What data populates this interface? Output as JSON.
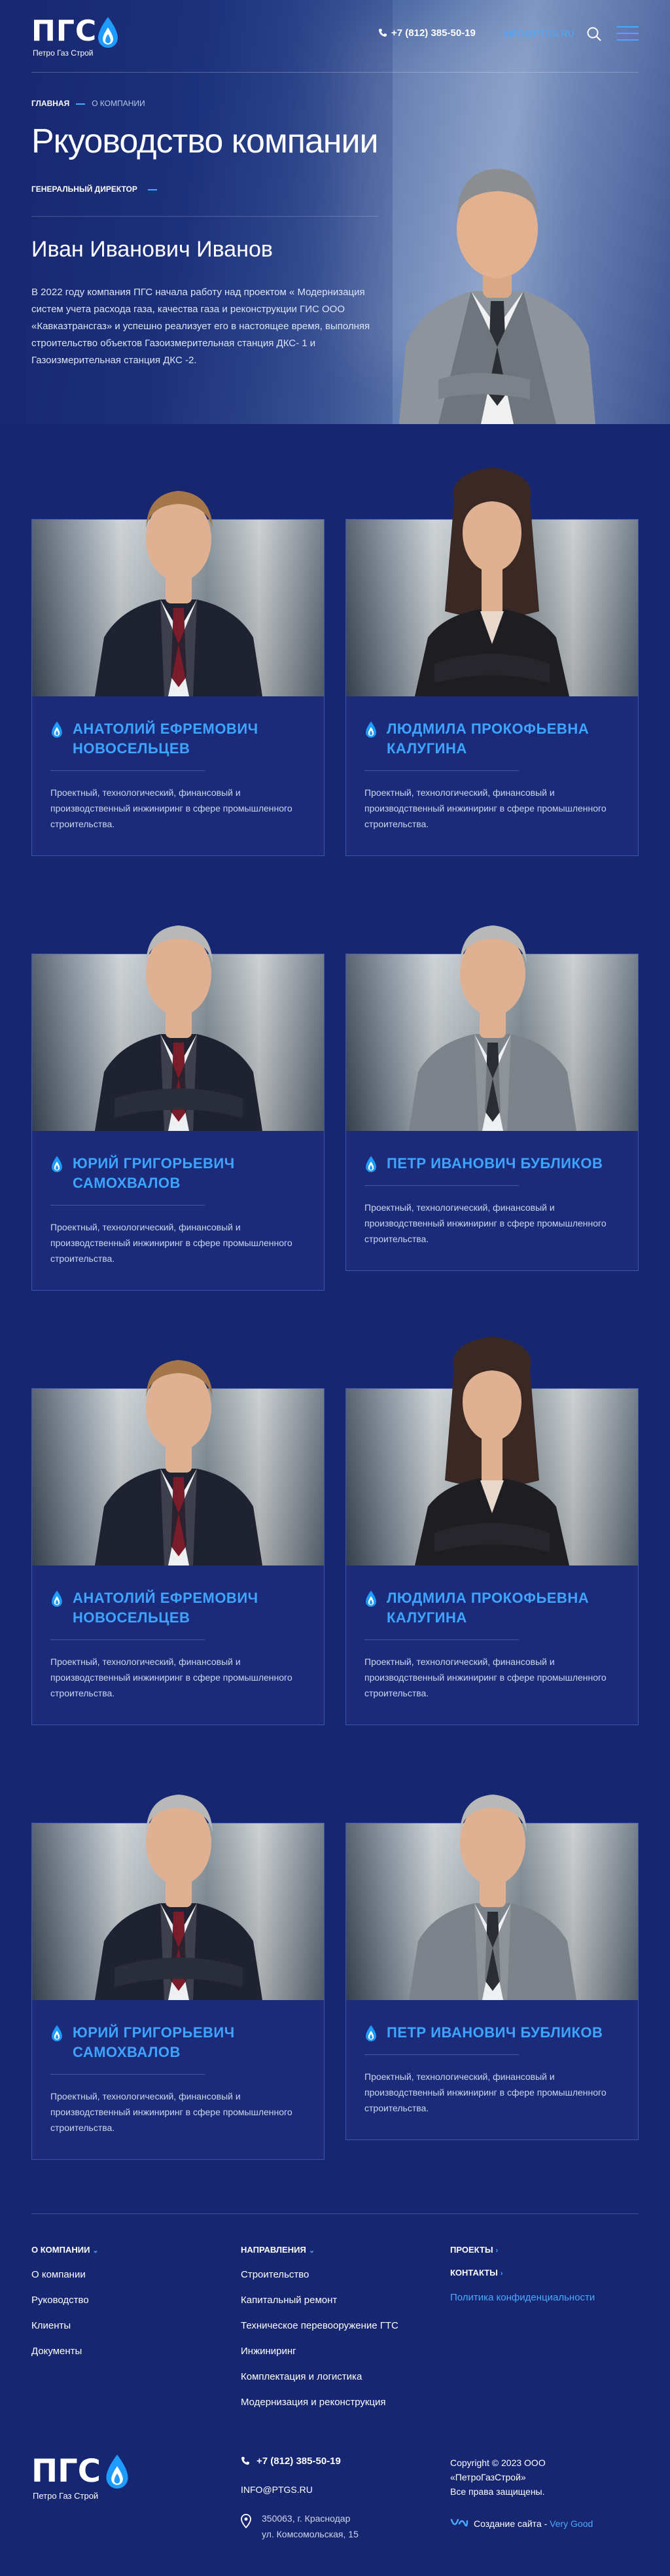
{
  "header": {
    "logo_text": "ПГС",
    "logo_sub": "Петро Газ Строй",
    "phone": "+7 (812) 385-50-19",
    "email": "INFO@PTGS.RU"
  },
  "breadcrumb": {
    "home": "ГЛАВНАЯ",
    "current": "О КОМПАНИИ"
  },
  "page_title": "Ркуоводство компании",
  "director": {
    "role": "ГЕНЕРАЛЬНЫЙ ДИРЕКТОР",
    "name": "Иван Иванович Иванов",
    "bio": "В 2022 году компания ПГС начала работу над проектом « Модернизация систем учета расхода газа, качества газа и реконструкции ГИС ООО «Кавказтрансгаз» и успешно реализует его в настоящее время, выполняя строительство объектов Газоизмерительная станция ДКС- 1 и Газоизмерительная станция ДКС -2."
  },
  "team": [
    {
      "line1": "Анатолий Ефремович",
      "line2": "Новосельцев",
      "desc": "Проектный, технологический, финансовый и производственный инжиниринг в сфере промышленного строительства."
    },
    {
      "line1": "Людмила Прокофьевна",
      "line2": "Калугина",
      "desc": "Проектный, технологический, финансовый и производственный инжиниринг в сфере промышленного строительства."
    },
    {
      "line1": "Юрий Григорьевич",
      "line2": "Самохвалов",
      "desc": "Проектный, технологический, финансовый и производственный инжиниринг в сфере промышленного строительства."
    },
    {
      "line1": "Петр Иванович Бубликов",
      "line2": "",
      "desc": "Проектный, технологический, финансовый и производственный инжиниринг в сфере промышленного строительства."
    },
    {
      "line1": "Анатолий Ефремович",
      "line2": "Новосельцев",
      "desc": "Проектный, технологический, финансовый и производственный инжиниринг в сфере промышленного строительства."
    },
    {
      "line1": "Людмила Прокофьевна",
      "line2": "Калугина",
      "desc": "Проектный, технологический, финансовый и производственный инжиниринг в сфере промышленного строительства."
    },
    {
      "line1": "Юрий Григорьевич",
      "line2": "Самохвалов",
      "desc": "Проектный, технологический, финансовый и производственный инжиниринг в сфере промышленного строительства."
    },
    {
      "line1": "Петр Иванович Бубликов",
      "line2": "",
      "desc": "Проектный, технологический, финансовый и производственный инжиниринг в сфере промышленного строительства."
    }
  ],
  "footer": {
    "col1": {
      "head": "О КОМПАНИИ",
      "links": [
        "О компании",
        "Руководство",
        "Клиенты",
        "Документы"
      ]
    },
    "col2": {
      "head": "НАПРАВЛЕНИЯ",
      "links": [
        "Строительство",
        "Капитальный ремонт",
        "Техническое перевооружение ГТС",
        "Инжиниринг",
        "Комплектация и логистика",
        "Модернизация и реконструкция"
      ]
    },
    "col3": {
      "projects": "ПРОЕКТЫ",
      "contacts": "КОНТАКТЫ",
      "privacy": "Политика конфиденциальности"
    },
    "phone": "+7 (812) 385-50-19",
    "email": "INFO@PTGS.RU",
    "address1": "350063, г. Краснодар",
    "address2": "ул. Комсомольская, 15",
    "copyright1": "Copyright © 2023 ООО",
    "copyright2": "«ПетроГазСтрой»",
    "copyright3": "Все права защищены.",
    "made_by": "Создание сайта -",
    "studio": "Very Good"
  },
  "colors": {
    "accent": "#3da5ff",
    "background": "#172670",
    "card": "#1b2b7a"
  }
}
